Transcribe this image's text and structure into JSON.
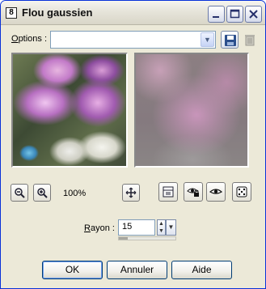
{
  "window": {
    "app_icon_label": "8",
    "title": "Flou gaussien"
  },
  "options": {
    "label_accel": "O",
    "label_rest": "ptions :",
    "value": ""
  },
  "zoom": {
    "level": "100%"
  },
  "rayon": {
    "label_accel": "R",
    "label_rest": "ayon :",
    "value": "15",
    "slider_fraction": 0.15
  },
  "buttons": {
    "ok": "OK",
    "cancel": "Annuler",
    "help": "Aide"
  }
}
